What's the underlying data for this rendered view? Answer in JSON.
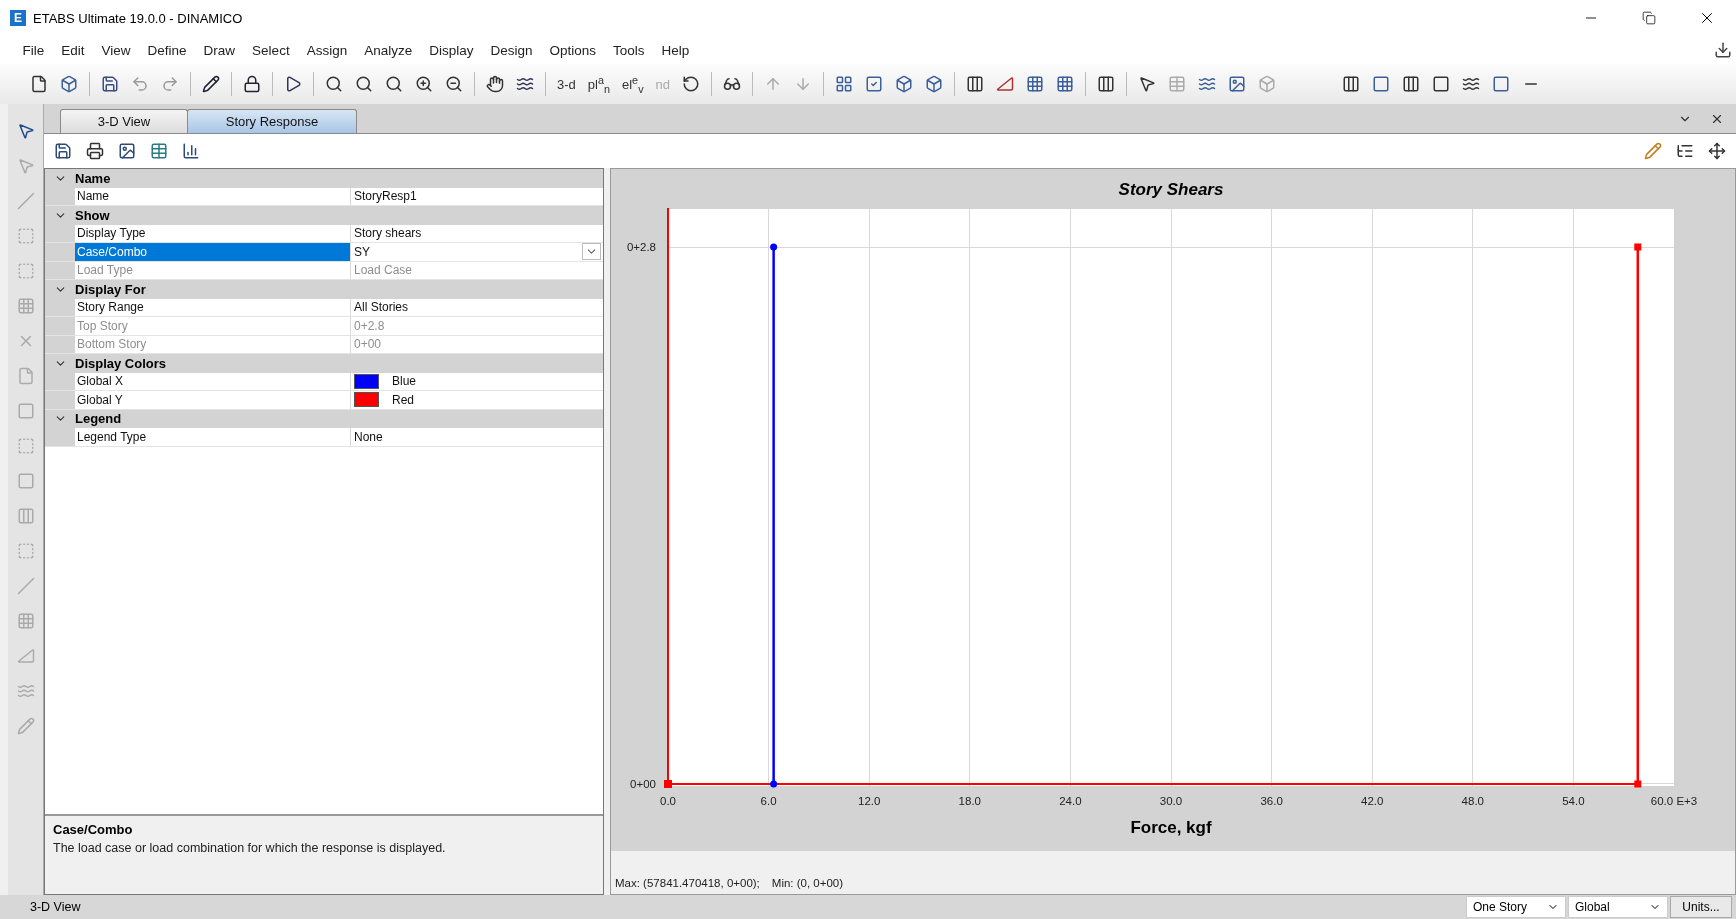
{
  "window": {
    "title": "ETABS Ultimate 19.0.0 - DINAMICO",
    "app_letter": "E"
  },
  "menu": [
    "File",
    "Edit",
    "View",
    "Define",
    "Draw",
    "Select",
    "Assign",
    "Analyze",
    "Display",
    "Design",
    "Options",
    "Tools",
    "Help"
  ],
  "toolbar": {
    "text_buttons": [
      {
        "label": "3-d",
        "disabled": false
      },
      {
        "label": "pl$^{a}$$_{n}$",
        "disabled": false
      },
      {
        "label": "el$^{e}$$_{v}$",
        "disabled": false
      },
      {
        "label": "nd",
        "disabled": true
      }
    ]
  },
  "tabs": [
    {
      "label": "3-D View",
      "selected": false
    },
    {
      "label": "Story Response",
      "selected": true
    }
  ],
  "property_grid": {
    "categories": [
      {
        "name": "Name",
        "expanded": true,
        "properties": [
          {
            "kind": "text",
            "label": "Name",
            "value": "StoryResp1",
            "disabled": false,
            "selected": false
          }
        ]
      },
      {
        "name": "Show",
        "expanded": true,
        "properties": [
          {
            "kind": "text",
            "label": "Display Type",
            "value": "Story shears",
            "disabled": false,
            "selected": false
          },
          {
            "kind": "combo",
            "label": "Case/Combo",
            "value": "SY",
            "disabled": false,
            "selected": true
          },
          {
            "kind": "text",
            "label": "Load Type",
            "value": "Load Case",
            "disabled": true,
            "selected": false
          }
        ]
      },
      {
        "name": "Display For",
        "expanded": true,
        "properties": [
          {
            "kind": "text",
            "label": "Story Range",
            "value": "All Stories",
            "disabled": false,
            "selected": false
          },
          {
            "kind": "text",
            "label": "Top Story",
            "value": "0+2.8",
            "disabled": true,
            "selected": false
          },
          {
            "kind": "text",
            "label": "Bottom Story",
            "value": "0+00",
            "disabled": true,
            "selected": false
          }
        ]
      },
      {
        "name": "Display Colors",
        "expanded": true,
        "properties": [
          {
            "kind": "color",
            "label": "Global X",
            "value": "Blue",
            "color": "#0000ff",
            "disabled": false,
            "selected": false
          },
          {
            "kind": "color",
            "label": "Global Y",
            "value": "Red",
            "color": "#ff0000",
            "disabled": false,
            "selected": false
          }
        ]
      },
      {
        "name": "Legend",
        "expanded": true,
        "properties": [
          {
            "kind": "text",
            "label": "Legend Type",
            "value": "None",
            "disabled": false,
            "selected": false
          }
        ]
      }
    ]
  },
  "description": {
    "title": "Case/Combo",
    "text": "The load case or load combination for which the response is displayed."
  },
  "chart": {
    "chart_data": {
      "type": "line",
      "orientation": "horizontal",
      "title": "Story Shears",
      "xlabel": "Force, kgf",
      "categories": [
        "0+2.8",
        "0+00"
      ],
      "series": [
        {
          "color": "#0000ff",
          "marker": "circle",
          "values": [
            6.3,
            6.3
          ]
        },
        {
          "color": "#ff0000",
          "marker": "square",
          "values": [
            57.84,
            57.84
          ]
        }
      ],
      "xlim": [
        0,
        60
      ],
      "xticks": [
        {
          "value": 0,
          "label": "0.0"
        },
        {
          "value": 6,
          "label": "6.0"
        },
        {
          "value": 12,
          "label": "12.0"
        },
        {
          "value": 18,
          "label": "18.0"
        },
        {
          "value": 24,
          "label": "24.0"
        },
        {
          "value": 30,
          "label": "30.0"
        },
        {
          "value": 36,
          "label": "36.0"
        },
        {
          "value": 42,
          "label": "42.0"
        },
        {
          "value": 48,
          "label": "48.0"
        },
        {
          "value": 54,
          "label": "54.0"
        },
        {
          "value": 60,
          "label": "60.0 E+3"
        }
      ]
    },
    "max_text": "Max: (57841.470418, 0+00);",
    "min_text": "Min: (0, 0+00)"
  },
  "status_bar": {
    "view": "3-D View",
    "story_dropdown": "One Story",
    "coord_dropdown": "Global",
    "units_button": "Units..."
  }
}
